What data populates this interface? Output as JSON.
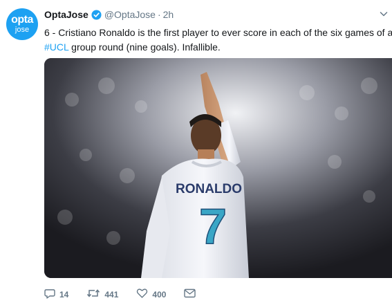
{
  "tweet": {
    "avatar": {
      "line1": "opta",
      "line2": "jose"
    },
    "author_name": "OptaJose",
    "handle": "@OptaJose",
    "separator": "·",
    "time": "2h",
    "text_line1": "6 - Cristiano Ronaldo is the first player to ever score in each of the six games of a",
    "hashtag": "#UCL",
    "text_line2_rest": " group round (nine goals). Infallible.",
    "image": {
      "jersey_name": "RONALDO",
      "jersey_number": "7"
    },
    "actions": {
      "replies": "14",
      "retweets": "441",
      "likes": "400"
    }
  },
  "colors": {
    "accent": "#1da1f2",
    "muted": "#657786",
    "text": "#14171a"
  }
}
